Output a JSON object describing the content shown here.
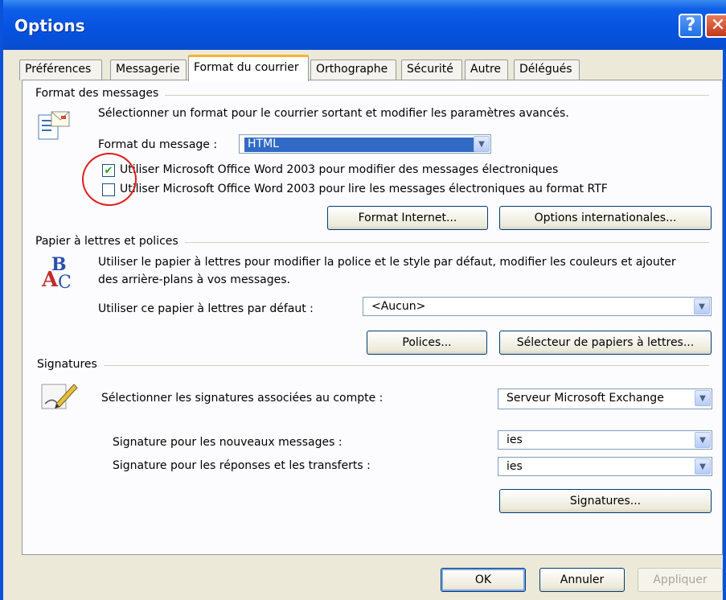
{
  "window": {
    "title": "Options",
    "help_glyph": "?",
    "close_glyph": "✕"
  },
  "tabs": [
    {
      "label": "Préférences",
      "active": false
    },
    {
      "label": "Messagerie",
      "active": false
    },
    {
      "label": "Format du courrier",
      "active": true
    },
    {
      "label": "Orthographe",
      "active": false
    },
    {
      "label": "Sécurité",
      "active": false
    },
    {
      "label": "Autre",
      "active": false
    },
    {
      "label": "Délégués",
      "active": false
    }
  ],
  "message_format": {
    "group_label": "Format des messages",
    "description": "Sélectionner un format pour le courrier sortant et modifier les paramètres avancés.",
    "format_label": "Format du message :",
    "format_value": "HTML",
    "use_word_edit": {
      "label": "Utiliser Microsoft Office Word 2003 pour modifier des messages électroniques",
      "checked": true
    },
    "use_word_read": {
      "label": "Utiliser Microsoft Office Word 2003 pour lire les messages électroniques au format RTF",
      "checked": false
    },
    "internet_format_button": "Format Internet...",
    "international_options_button": "Options internationales..."
  },
  "stationery": {
    "group_label": "Papier à lettres et polices",
    "description_line1": "Utiliser le papier à lettres pour modifier la police et le style par défaut, modifier les couleurs et ajouter",
    "description_line2": "des arrière-plans à vos messages.",
    "default_label": "Utiliser ce papier à lettres par défaut :",
    "default_value": "<Aucun>",
    "fonts_button": "Polices...",
    "picker_button": "Sélecteur de papiers à lettres..."
  },
  "signatures": {
    "group_label": "Signatures",
    "account_label": "Sélectionner les signatures associées au compte :",
    "account_value": "Serveur Microsoft Exchange",
    "new_label": "Signature pour les nouveaux messages :",
    "new_value": "ies",
    "reply_label": "Signature pour les réponses et les transferts :",
    "reply_value": "ies",
    "signatures_button": "Signatures..."
  },
  "footer": {
    "ok": "OK",
    "cancel": "Annuler",
    "apply": "Appliquer"
  },
  "colors": {
    "titlebar": "#0754e2",
    "highlight": "#316ac5",
    "annotation_circle": "#e01e1e"
  }
}
